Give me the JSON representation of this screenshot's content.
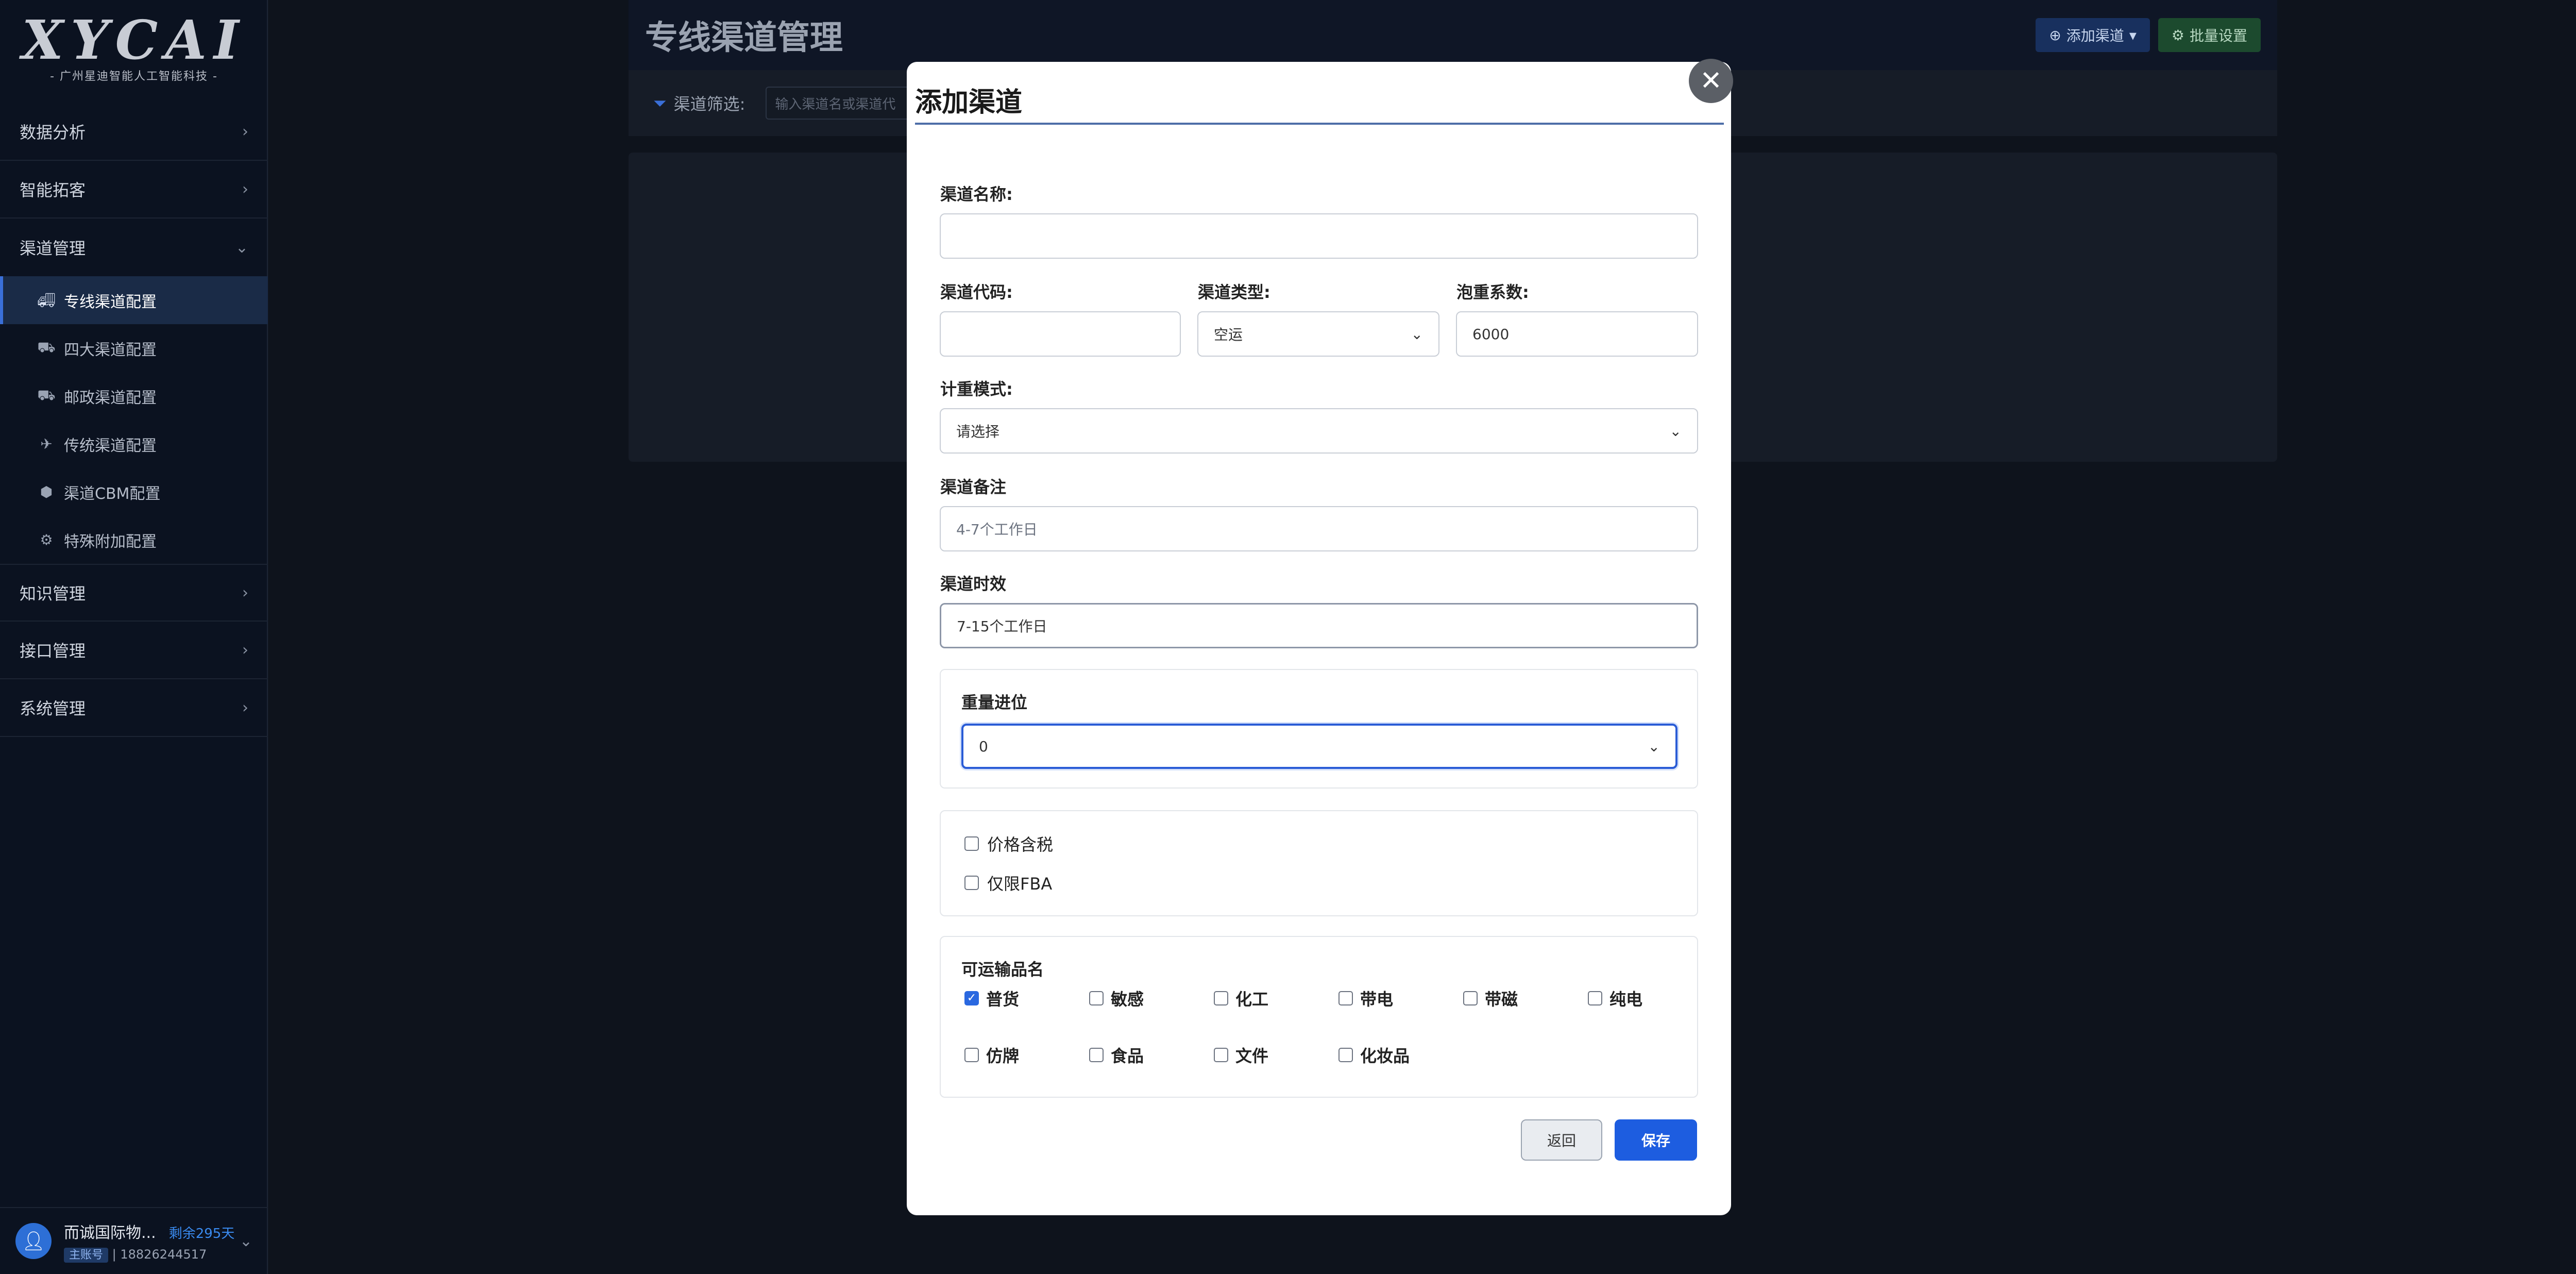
{
  "sidebar": {
    "logo": "XYCAI",
    "logo_sub": "- 广州星迪智能人工智能科技 -",
    "nav": [
      {
        "label": "数据分析"
      },
      {
        "label": "智能拓客"
      },
      {
        "label": "渠道管理"
      }
    ],
    "sub_items": [
      {
        "label": "专线渠道配置",
        "icon": "truck-icon"
      },
      {
        "label": "四大渠道配置",
        "icon": "truck-fast-icon"
      },
      {
        "label": "邮政渠道配置",
        "icon": "truck-fast-icon"
      },
      {
        "label": "传统渠道配置",
        "icon": "plane-icon"
      },
      {
        "label": "渠道CBM配置",
        "icon": "box-icon"
      },
      {
        "label": "特殊附加配置",
        "icon": "gear-icon"
      }
    ],
    "nav_after": [
      {
        "label": "知识管理"
      },
      {
        "label": "接口管理"
      },
      {
        "label": "系统管理"
      }
    ],
    "user": {
      "name": "而诚国际物...",
      "days": "剩余295天",
      "role": "主账号",
      "phone": "18826244517"
    }
  },
  "page": {
    "title": "专线渠道管理",
    "add_button": "添加渠道",
    "batch_button": "批量设置",
    "filter_label": "渠道筛选:",
    "filter_placeholder": "输入渠道名或渠道代"
  },
  "modal": {
    "title": "添加渠道",
    "name_label": "渠道名称:",
    "name_value": "",
    "code_label": "渠道代码:",
    "code_value": "",
    "type_label": "渠道类型:",
    "type_value": "空运",
    "factor_label": "泡重系数:",
    "factor_value": "6000",
    "weight_mode_label": "计重模式:",
    "weight_mode_value": "请选择",
    "remark_label": "渠道备注",
    "remark_placeholder": "4-7个工作日",
    "timeliness_label": "渠道时效",
    "timeliness_value": "7-15个工作日",
    "rounding_label": "重量进位",
    "rounding_value": "0",
    "tax_label": "价格含税",
    "fba_label": "仅限FBA",
    "cargo_label": "可运输品名",
    "cargo": [
      {
        "label": "普货",
        "checked": true
      },
      {
        "label": "敏感",
        "checked": false
      },
      {
        "label": "化工",
        "checked": false
      },
      {
        "label": "带电",
        "checked": false
      },
      {
        "label": "带磁",
        "checked": false
      },
      {
        "label": "纯电",
        "checked": false
      },
      {
        "label": "仿牌",
        "checked": false
      },
      {
        "label": "食品",
        "checked": false
      },
      {
        "label": "文件",
        "checked": false
      },
      {
        "label": "化妆品",
        "checked": false
      }
    ],
    "back_button": "返回",
    "save_button": "保存"
  },
  "colors": {
    "sidebar_bg": "#0b1220",
    "primary": "#1d5de0",
    "modal_bg": "#ffffff"
  }
}
